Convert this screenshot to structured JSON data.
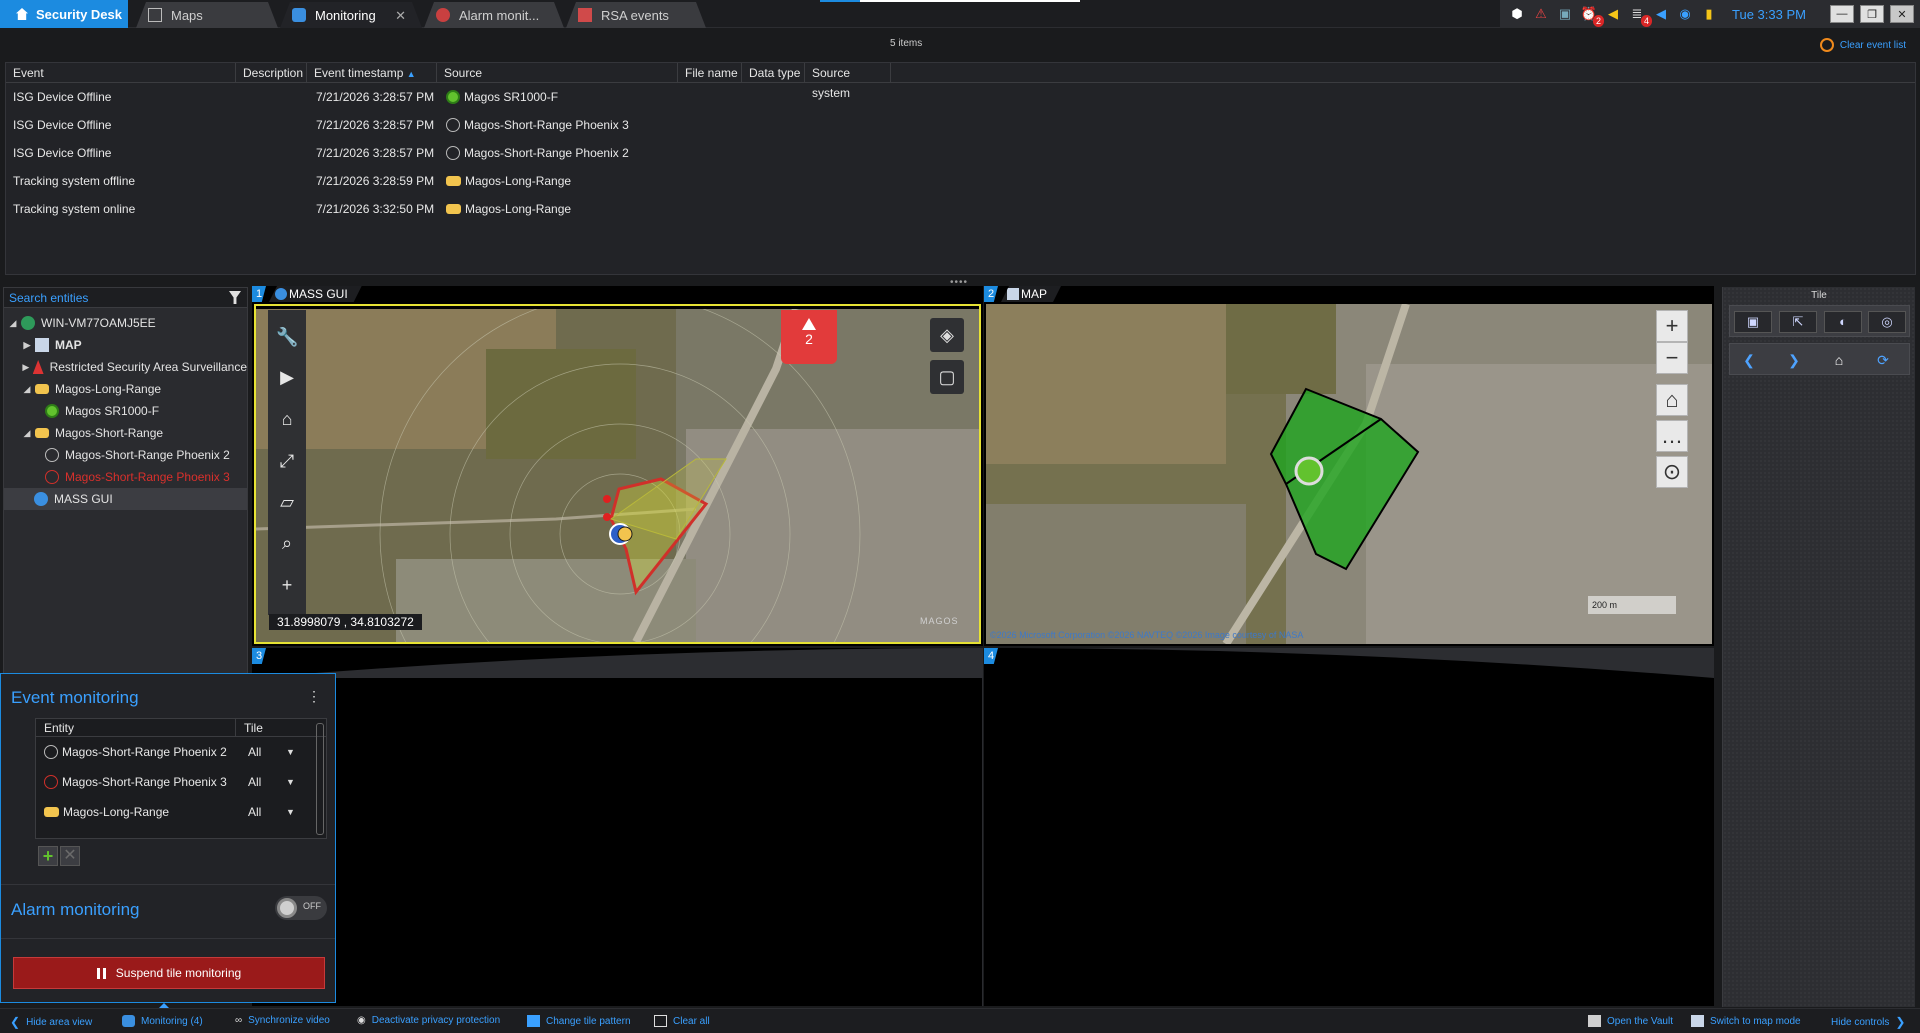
{
  "app": {
    "name": "Security Desk"
  },
  "tabs": [
    {
      "label": "Maps"
    },
    {
      "label": "Monitoring"
    },
    {
      "label": "Alarm monit..."
    },
    {
      "label": "RSA events"
    }
  ],
  "tray": {
    "clock": "Tue 3:33 PM",
    "badges": [
      "2",
      "4"
    ]
  },
  "event_list": {
    "count_text": "5 items",
    "clear_label": "Clear event list",
    "columns": [
      "Event",
      "Description",
      "Event timestamp",
      "Source",
      "File name",
      "Data type",
      "Source system"
    ],
    "rows": [
      {
        "event": "ISG Device Offline",
        "timestamp": "7/21/2026 3:28:57 PM",
        "source": "Magos SR1000-F",
        "icon": "green-device-icon"
      },
      {
        "event": "ISG Device Offline",
        "timestamp": "7/21/2026 3:28:57 PM",
        "source": "Magos-Short-Range Phoenix 3",
        "icon": "radar-ring-icon"
      },
      {
        "event": "ISG Device Offline",
        "timestamp": "7/21/2026 3:28:57 PM",
        "source": "Magos-Short-Range Phoenix 2",
        "icon": "radar-ring-icon"
      },
      {
        "event": "Tracking system offline",
        "timestamp": "7/21/2026 3:28:59 PM",
        "source": "Magos-Long-Range",
        "icon": "drone-icon"
      },
      {
        "event": "Tracking system online",
        "timestamp": "7/21/2026 3:32:50 PM",
        "source": "Magos-Long-Range",
        "icon": "drone-icon"
      }
    ]
  },
  "tree": {
    "search_placeholder": "Search entities",
    "nodes": [
      {
        "label": "WIN-VM77OAMJ5EE"
      },
      {
        "label": "MAP"
      },
      {
        "label": "Restricted Security Area Surveillance"
      },
      {
        "label": "Magos-Long-Range"
      },
      {
        "label": "Magos SR1000-F"
      },
      {
        "label": "Magos-Short-Range"
      },
      {
        "label": "Magos-Short-Range Phoenix 2"
      },
      {
        "label": "Magos-Short-Range Phoenix 3"
      },
      {
        "label": "MASS GUI"
      }
    ]
  },
  "tiles": [
    {
      "num": "1",
      "title": "MASS GUI",
      "alarm_count": "2",
      "coords": "31.8998079 , 34.8103272",
      "logo": "MAGOS"
    },
    {
      "num": "2",
      "title": "MAP",
      "scale": "200 m",
      "copyright": "©2026 Microsoft Corporation ©2026 NAVTEQ ©2026 Image courtesy of NASA"
    },
    {
      "num": "3"
    },
    {
      "num": "4"
    }
  ],
  "tile_controls": {
    "header": "Tile"
  },
  "event_monitoring": {
    "title": "Event monitoring",
    "columns": [
      "Entity",
      "Tile"
    ],
    "rows": [
      {
        "entity": "Magos-Short-Range Phoenix 2",
        "tile": "All"
      },
      {
        "entity": "Magos-Short-Range Phoenix 3",
        "tile": "All"
      },
      {
        "entity": "Magos-Long-Range",
        "tile": "All"
      }
    ]
  },
  "alarm_monitoring": {
    "title": "Alarm monitoring",
    "toggle": "OFF"
  },
  "suspend_label": "Suspend tile monitoring",
  "bottombar": {
    "hide_area": "Hide area view",
    "monitoring": "Monitoring (4)",
    "sync": "Synchronize video",
    "privacy": "Deactivate privacy protection",
    "pattern": "Change tile pattern",
    "clear_all": "Clear all",
    "vault": "Open the Vault",
    "map_mode": "Switch to map mode",
    "hide_controls": "Hide controls"
  },
  "colors": {
    "accent": "#1c8be0",
    "link": "#3aa0ff",
    "alarm": "#e23b3b",
    "zone_green": "#1fb31f",
    "zone_red": "#d0302a"
  }
}
